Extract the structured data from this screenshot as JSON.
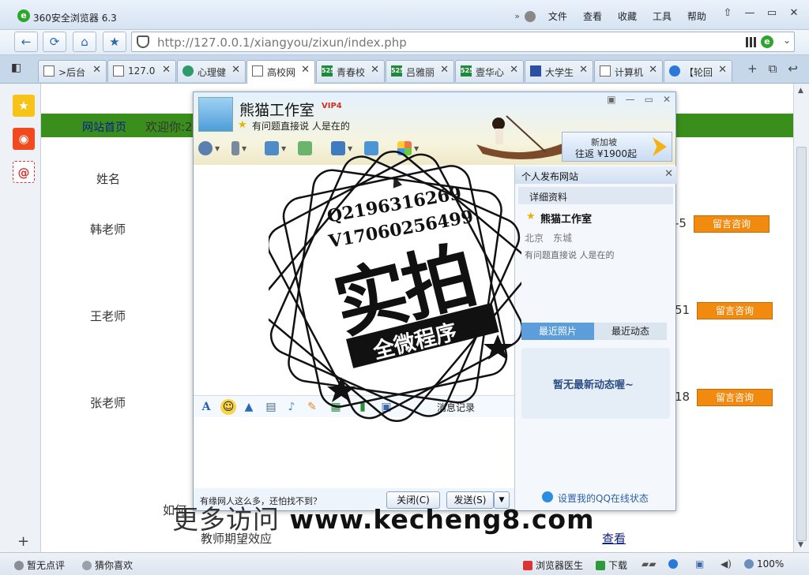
{
  "window": {
    "app_title": "360安全浏览器 6.3",
    "menu": [
      "文件",
      "查看",
      "收藏",
      "工具",
      "帮助"
    ],
    "controls": [
      "⇧",
      "—",
      "▭",
      "✕"
    ]
  },
  "nav": {
    "back": "←",
    "refresh": "⟳",
    "home": "⌂",
    "favorite": "★",
    "url": "http://127.0.0.1/xiangyou/zixun/index.php"
  },
  "tabs": [
    {
      "label": ">后台",
      "icon": "page"
    },
    {
      "label": "127.0",
      "icon": "page"
    },
    {
      "label": "心理健",
      "icon": "green"
    },
    {
      "label": "高校网",
      "icon": "page",
      "active": true
    },
    {
      "label": "青春校",
      "icon": "b525",
      "badge": "525"
    },
    {
      "label": "吕雅丽",
      "icon": "b525",
      "badge": "525"
    },
    {
      "label": "壹华心",
      "icon": "b525",
      "badge": "525"
    },
    {
      "label": "大学生",
      "icon": "paw"
    },
    {
      "label": "计算机",
      "icon": "page"
    },
    {
      "label": "【轮回",
      "icon": "blue"
    }
  ],
  "tab_tools": [
    "+",
    "⧉",
    "↩"
  ],
  "page": {
    "home_link": "网站首页",
    "welcome": "欢迎你:2",
    "column_name": "姓名",
    "teachers": [
      {
        "name": "韩老师",
        "num": "-5",
        "button": "留言咨询"
      },
      {
        "name": "王老师",
        "num": "51",
        "button": "留言咨询"
      },
      {
        "name": "张老师",
        "num": "18",
        "button": "留言咨询"
      }
    ],
    "ask_line": "如何",
    "effect": "教师期望效应",
    "view": "查看"
  },
  "qq": {
    "name": "熊猫工作室",
    "vip": "VIP4",
    "signature": "有问题直接说 人是在的",
    "ad_line1": "新加坡",
    "ad_line2": "往返 ¥1900起",
    "history": "消息记录",
    "bottom_ad": "有缘网人这么多，还怕找不到？",
    "close_btn": "关闭(C)",
    "send_btn": "发送(S)",
    "send_drop": "▼",
    "panel": {
      "title": "个人发布网站",
      "detail": "详细资料",
      "name": "熊猫工作室",
      "location": "北京　东城",
      "signature": "有问题直接说 人是在的",
      "tab_photos": "最近照片",
      "tab_activity": "最近动态",
      "feed_empty": "暂无最新动态喔~",
      "status_link": "设置我的QQ在线状态"
    }
  },
  "stamp": {
    "line1": "Q2196316269",
    "line2": "V17060256499",
    "big": "实拍",
    "band": "全微程序"
  },
  "watermark": {
    "cn": "更多访问",
    "url": "www.kecheng8.com"
  },
  "status": {
    "no_review": "暂无点评",
    "guess": "猜你喜欢",
    "doctor": "浏览器医生",
    "download": "下载",
    "zoom": "100%"
  }
}
